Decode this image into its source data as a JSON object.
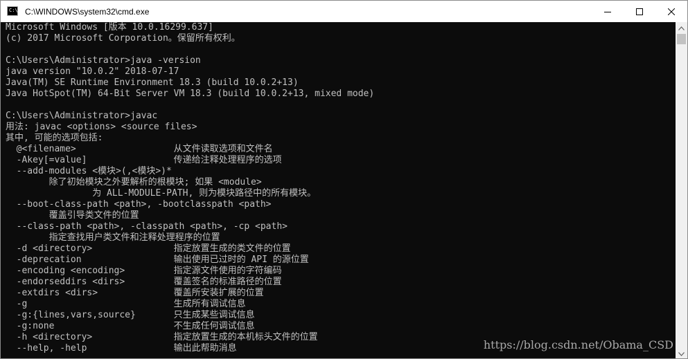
{
  "window": {
    "title": "C:\\WINDOWS\\system32\\cmd.exe",
    "icon": "cmd-icon"
  },
  "controls": {
    "minimize_icon": "minimize-icon",
    "maximize_icon": "maximize-icon",
    "close_icon": "close-icon"
  },
  "colors": {
    "console_background": "#0c0c0c",
    "console_text": "#c0c0c0",
    "titlebar_background": "#ffffff"
  },
  "console": {
    "lines": [
      "Microsoft Windows [版本 10.0.16299.637]",
      "(c) 2017 Microsoft Corporation。保留所有权利。",
      "",
      "C:\\Users\\Administrator>java -version",
      "java version \"10.0.2\" 2018-07-17",
      "Java(TM) SE Runtime Environment 18.3 (build 10.0.2+13)",
      "Java HotSpot(TM) 64-Bit Server VM 18.3 (build 10.0.2+13, mixed mode)",
      "",
      "C:\\Users\\Administrator>javac",
      "用法: javac <options> <source files>",
      "其中, 可能的选项包括:",
      "  @<filename>                  从文件读取选项和文件名",
      "  -Akey[=value]                传递给注释处理程序的选项",
      "  --add-modules <模块>(,<模块>)*",
      "        除了初始模块之外要解析的根模块; 如果 <module>",
      "                为 ALL-MODULE-PATH, 则为模块路径中的所有模块。",
      "  --boot-class-path <path>, -bootclasspath <path>",
      "        覆盖引导类文件的位置",
      "  --class-path <path>, -classpath <path>, -cp <path>",
      "        指定查找用户类文件和注释处理程序的位置",
      "  -d <directory>               指定放置生成的类文件的位置",
      "  -deprecation                 输出使用已过时的 API 的源位置",
      "  -encoding <encoding>         指定源文件使用的字符编码",
      "  -endorseddirs <dirs>         覆盖签名的标准路径的位置",
      "  -extdirs <dirs>              覆盖所安装扩展的位置",
      "  -g                           生成所有调试信息",
      "  -g:{lines,vars,source}       只生成某些调试信息",
      "  -g:none                      不生成任何调试信息",
      "  -h <directory>               指定放置生成的本机标头文件的位置",
      "  --help, -help                输出此帮助消息"
    ]
  },
  "scrollbar": {
    "up_icon": "scroll-up-arrow-icon",
    "down_icon": "scroll-down-arrow-icon"
  },
  "watermark": "https://blog.csdn.net/Obama_CSD"
}
